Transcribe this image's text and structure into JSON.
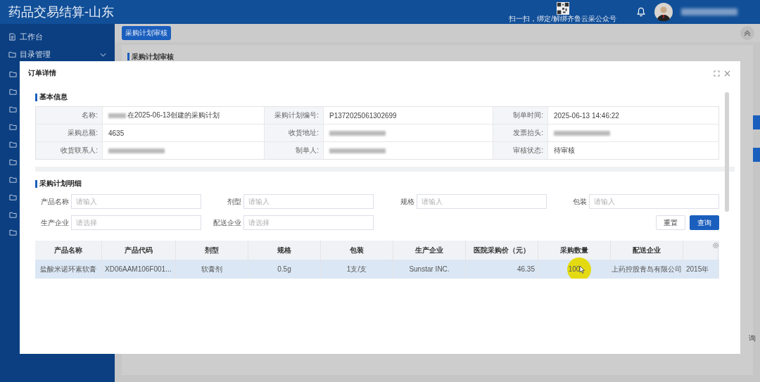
{
  "app": {
    "title": "药品交易结算-山东",
    "qr_caption": "扫一扫，绑定/解绑齐鲁云采公众号"
  },
  "sidebar": {
    "items": [
      {
        "label": "工作台",
        "expandable": false
      },
      {
        "label": "目录管理",
        "expandable": true
      }
    ]
  },
  "page": {
    "tab": "采购计划审核",
    "section_title": "采购计划审核",
    "behind_button_text": "询"
  },
  "modal": {
    "title": "订单详情",
    "basic_title": "基本信息",
    "basic_rows": [
      [
        {
          "label": "名称:",
          "value": "在2025-06-13创建的采购计划",
          "redacted_prefix": true
        },
        {
          "label": "采购计划编号:",
          "value": "P1372025061302699"
        },
        {
          "label": "制单时间:",
          "value": "2025-06-13 14:46:22"
        }
      ],
      [
        {
          "label": "采购总额:",
          "value": "4635"
        },
        {
          "label": "收货地址:"
        },
        {
          "label": "发票抬头:"
        }
      ],
      [
        {
          "label": "收货联系人:"
        },
        {
          "label": "制单人:"
        },
        {
          "label": "审核状态:",
          "value": "待审核"
        }
      ]
    ],
    "detail_title": "采购计划明细",
    "filters": [
      {
        "label": "产品名称",
        "placeholder": "请输入"
      },
      {
        "label": "剂型",
        "placeholder": "请输入"
      },
      {
        "label": "规格",
        "placeholder": "请输入"
      },
      {
        "label": "包装",
        "placeholder": "请输入"
      },
      {
        "label": "生产企业",
        "placeholder": "请选择"
      },
      {
        "label": "配送企业",
        "placeholder": "请选择"
      }
    ],
    "buttons": [
      {
        "label": "重置",
        "kind": "plain"
      },
      {
        "label": "查询",
        "kind": "primary"
      }
    ],
    "table": {
      "columns": [
        "产品名称",
        "产品代码",
        "剂型",
        "规格",
        "包装",
        "生产企业",
        "医院采购价（元）",
        "采购数量",
        "配送企业"
      ],
      "rows": [
        {
          "selected": true,
          "cells": [
            "盐酸米诺环素软膏",
            "XD06AAM106F001...",
            "软膏剂",
            "0.5g",
            "1支/支",
            "Sunstar INC.",
            "46.35",
            "100",
            "上药控股青岛有限公司",
            "2015年"
          ]
        }
      ]
    }
  }
}
